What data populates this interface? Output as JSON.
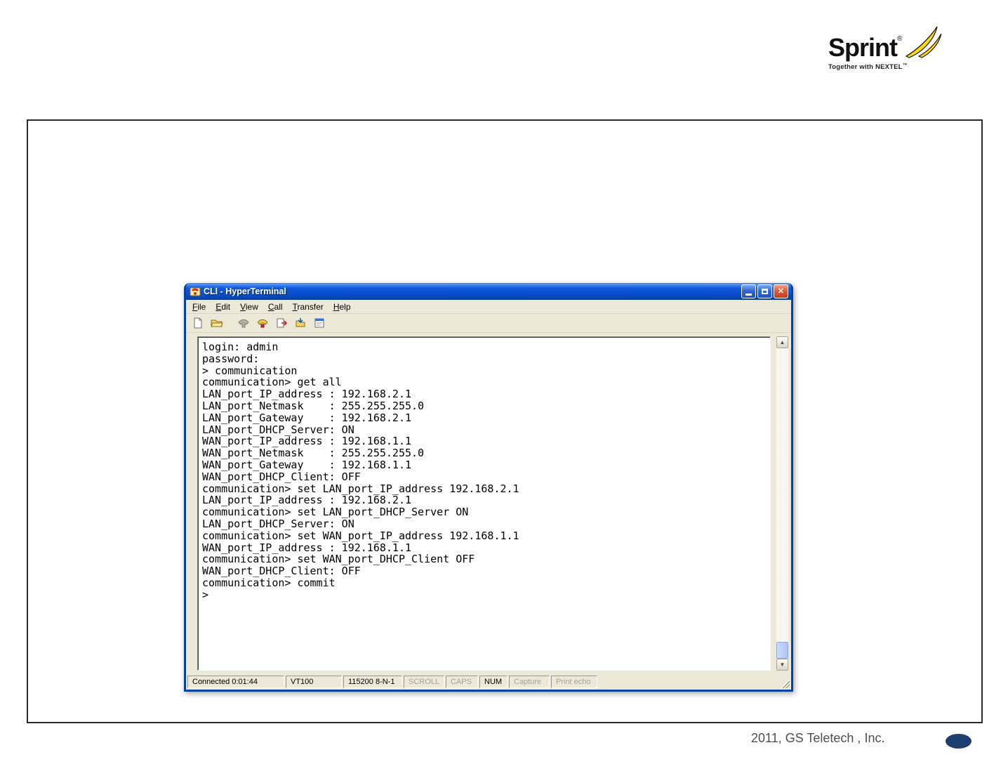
{
  "slide": {
    "logo": {
      "brand": "Sprint",
      "brand_mark": "®",
      "tagline": "Together with NEXTEL",
      "tagline_mark": "™"
    },
    "footer_text": "2011, GS Teletech , Inc."
  },
  "window": {
    "title": "CLI - HyperTerminal",
    "menu": [
      "File",
      "Edit",
      "View",
      "Call",
      "Transfer",
      "Help"
    ],
    "toolbar_icons": [
      "new-file",
      "open-folder",
      "call-disabled",
      "call-phone",
      "send-file",
      "receive-file",
      "properties"
    ],
    "terminal_lines": [
      "login: admin",
      "password:",
      "> communication",
      "communication> get all",
      "LAN_port_IP_address : 192.168.2.1",
      "LAN_port_Netmask    : 255.255.255.0",
      "LAN_port_Gateway    : 192.168.2.1",
      "LAN_port_DHCP_Server: ON",
      "WAN_port_IP_address : 192.168.1.1",
      "WAN_port_Netmask    : 255.255.255.0",
      "WAN_port_Gateway    : 192.168.1.1",
      "WAN_port_DHCP_Client: OFF",
      "communication> set LAN_port_IP_address 192.168.2.1",
      "LAN_port_IP_address : 192.168.2.1",
      "communication> set LAN_port_DHCP_Server ON",
      "LAN_port_DHCP_Server: ON",
      "communication> set WAN_port_IP_address 192.168.1.1",
      "WAN_port_IP_address : 192.168.1.1",
      "communication> set WAN_port_DHCP_Client OFF",
      "WAN_port_DHCP_Client: OFF",
      "communication> commit",
      ">"
    ],
    "statusbar": {
      "connection": "Connected 0:01:44",
      "emulation": "VT100",
      "settings": "115200 8-N-1",
      "scroll": "SCROLL",
      "caps": "CAPS",
      "num": "NUM",
      "capture": "Capture",
      "print_echo": "Print echo"
    }
  },
  "colors": {
    "titlebar_blue": "#0a4fd0",
    "close_red": "#e25937",
    "sprint_yellow": "#ffdd00",
    "footer_ellipse_navy": "#1d3e6e"
  }
}
